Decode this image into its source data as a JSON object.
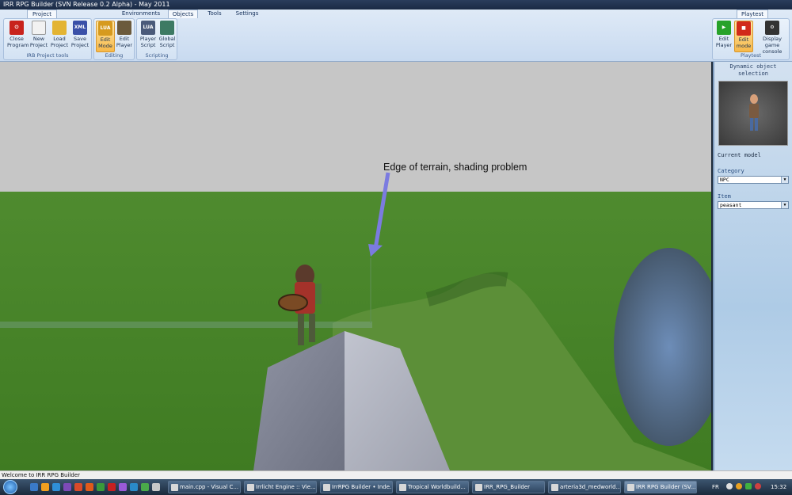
{
  "window": {
    "title": "IRR RPG Builder (SVN Release 0.2 Alpha) - May 2011"
  },
  "tabs": {
    "project": "Project",
    "environments": "Environments",
    "objects": "Objects",
    "tools": "Tools",
    "settings": "Settings",
    "playtest": "Playtest"
  },
  "groups": {
    "project_tools": {
      "label": "IRB Project tools",
      "buttons": [
        {
          "line1": "Close",
          "line2": "Program",
          "icon": "power-icon",
          "color": "#c8231d"
        },
        {
          "line1": "New",
          "line2": "Project",
          "icon": "new-document-icon",
          "color": "#f2f2f2"
        },
        {
          "line1": "Load",
          "line2": "Project",
          "icon": "folder-icon",
          "color": "#e3b433"
        },
        {
          "line1": "Save",
          "line2": "Project",
          "icon": "xml-save-icon",
          "color": "#3a50a8"
        }
      ]
    },
    "editing": {
      "label": "Editing",
      "buttons": [
        {
          "line1": "Edit",
          "line2": "Mode",
          "icon": "lua-edit-icon",
          "color": "#d69a1f"
        },
        {
          "line1": "Edit",
          "line2": "Player",
          "icon": "player-edit-icon",
          "color": "#6b5a3c"
        }
      ]
    },
    "scripting": {
      "label": "Scripting",
      "buttons": [
        {
          "line1": "Player",
          "line2": "Script",
          "icon": "lua-script-icon",
          "color": "#4a5a7a"
        },
        {
          "line1": "Global",
          "line2": "Script",
          "icon": "global-script-icon",
          "color": "#3d7a63"
        }
      ]
    },
    "playtest": {
      "label": "Playtest",
      "buttons": [
        {
          "line1": "Edit",
          "line2": "Player",
          "icon": "play-icon",
          "color": "#26a22a"
        },
        {
          "line1": "Edit",
          "line2": "mode",
          "icon": "stop-icon",
          "color": "#d12a1a"
        },
        {
          "line1": "Display",
          "line2": "game console",
          "icon": "console-gear-icon",
          "color": "#333333"
        }
      ]
    }
  },
  "viewport": {
    "annotation": "Edge of terrain, shading problem"
  },
  "panel": {
    "title": "Dynamic object selection",
    "current_model": "Current model",
    "category_label": "Category",
    "category_value": "NPC",
    "item_label": "Item",
    "item_value": "peasant"
  },
  "statusbar": {
    "text": "Welcome to IRR RPG Builder"
  },
  "taskbar": {
    "items": [
      {
        "label": "main.cpp - Visual C..."
      },
      {
        "label": "Irrlicht Engine :: Vie..."
      },
      {
        "label": "IrrRPG Builder • Inde..."
      },
      {
        "label": "Tropical Worldbuild..."
      },
      {
        "label": "IRR_RPG_Builder"
      },
      {
        "label": "arteria3d_medworld..."
      },
      {
        "label": "IRR RPG Builder (SV..."
      }
    ],
    "language": "FR",
    "clock": "15:32"
  }
}
